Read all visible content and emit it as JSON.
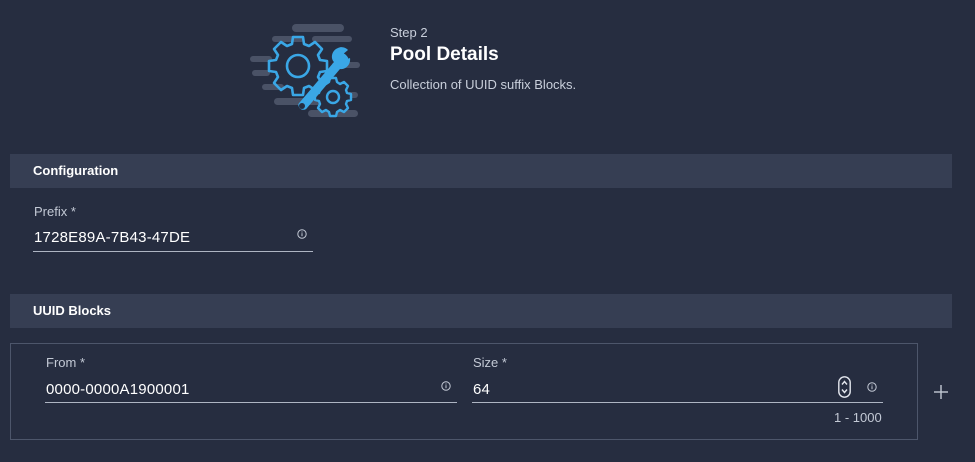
{
  "header": {
    "step_label": "Step 2",
    "title": "Pool Details",
    "description": "Collection of UUID suffix Blocks."
  },
  "configuration": {
    "section_title": "Configuration",
    "prefix": {
      "label": "Prefix *",
      "value": "1728E89A-7B43-47DE",
      "icon": "info-icon"
    }
  },
  "uuid_blocks": {
    "section_title": "UUID Blocks",
    "blocks": [
      {
        "from": {
          "label": "From *",
          "value": "0000-0000A1900001",
          "icon": "info-icon"
        },
        "size": {
          "label": "Size *",
          "value": "64",
          "range": "1 - 1000",
          "icon": "info-icon"
        }
      }
    ],
    "add_icon": "plus-icon"
  },
  "colors": {
    "background": "#262d40",
    "section_bar": "#363e53",
    "accent": "#3aa7e6",
    "illustration_gray": "#4a5266"
  }
}
